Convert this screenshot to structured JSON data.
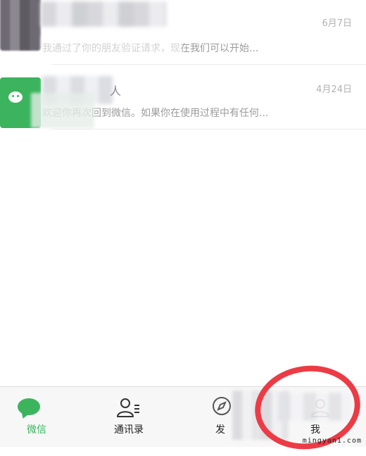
{
  "chats": [
    {
      "time": "6月7日",
      "preview": "我通过了你的朋友验证请求，现在我们可以开始..."
    },
    {
      "name_suffix": "人",
      "time": "4月24日",
      "preview": "欢迎你再次回到微信。如果你在使用过程中有任何..."
    }
  ],
  "tabbar": {
    "tabs": [
      {
        "label": "微信",
        "icon": "chat-bubble-icon",
        "active": true
      },
      {
        "label": "通讯录",
        "icon": "contacts-icon",
        "active": false
      },
      {
        "label": "发",
        "icon": "discover-icon",
        "active": false
      },
      {
        "label": "我",
        "icon": "me-icon",
        "active": false
      }
    ]
  },
  "colors": {
    "accent": "#3bb45d",
    "annotation_circle": "#ec3b45",
    "tabbar_bg": "#f7f7f7"
  },
  "watermark": "mingyan1.com"
}
